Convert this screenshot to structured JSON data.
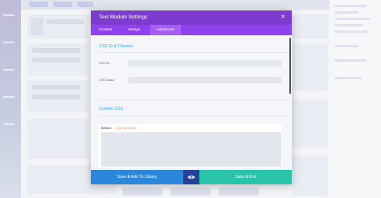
{
  "modal": {
    "title": "Text Module Settings",
    "close_icon": "close-icon"
  },
  "tabs": [
    {
      "label": "Content"
    },
    {
      "label": "Design"
    },
    {
      "label": "Advanced",
      "active": true
    }
  ],
  "sections": {
    "css_id_classes": {
      "title": "CSS ID & Classes",
      "css_id_label": "CSS ID:",
      "css_id_value": "",
      "css_class_label": "CSS Class:",
      "css_class_value": ""
    },
    "custom_css": {
      "title": "Custom CSS",
      "before_label": "Before:",
      "selector_hint": "et_pb_text:before",
      "before_value": ""
    }
  },
  "footer": {
    "library_label": "Save & Add To Library",
    "preview_icon": "eye-icon",
    "save_label": "Save & Exit"
  },
  "colors": {
    "header": "#7e3bd0",
    "tabbar": "#8f42ec",
    "section_title": "#2ea3f2",
    "library_button": "#2b87da",
    "preview_button": "#25429a",
    "save_button": "#29c4a9"
  }
}
